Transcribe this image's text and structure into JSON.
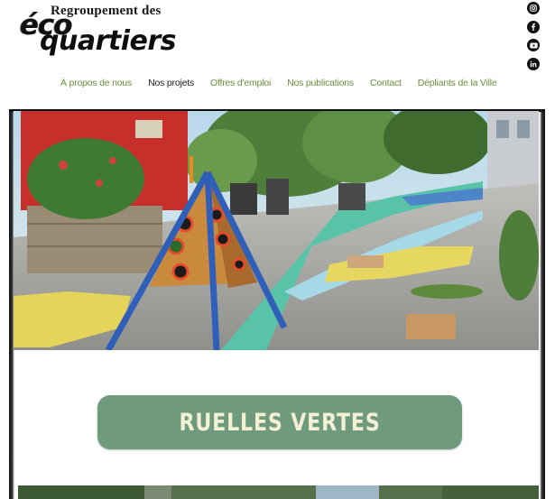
{
  "brand": {
    "line1": "Regroupement des",
    "eco": "éco",
    "quartiers": "quartiers"
  },
  "social": [
    {
      "name": "instagram-icon"
    },
    {
      "name": "facebook-icon"
    },
    {
      "name": "youtube-icon"
    },
    {
      "name": "linkedin-icon"
    }
  ],
  "nav": {
    "items": [
      {
        "label": "À propos de nous"
      },
      {
        "label": "Nos projets"
      },
      {
        "label": "Offres d'emploi"
      },
      {
        "label": "Nos publications"
      },
      {
        "label": "Contact"
      },
      {
        "label": "Dépliants de la Ville"
      }
    ],
    "active_index": 1
  },
  "main": {
    "title": "RUELLES VERTES"
  },
  "colors": {
    "nav_link": "#6b8f3b",
    "banner": "#6f9a7e",
    "banner_text": "#f3f0d4"
  }
}
